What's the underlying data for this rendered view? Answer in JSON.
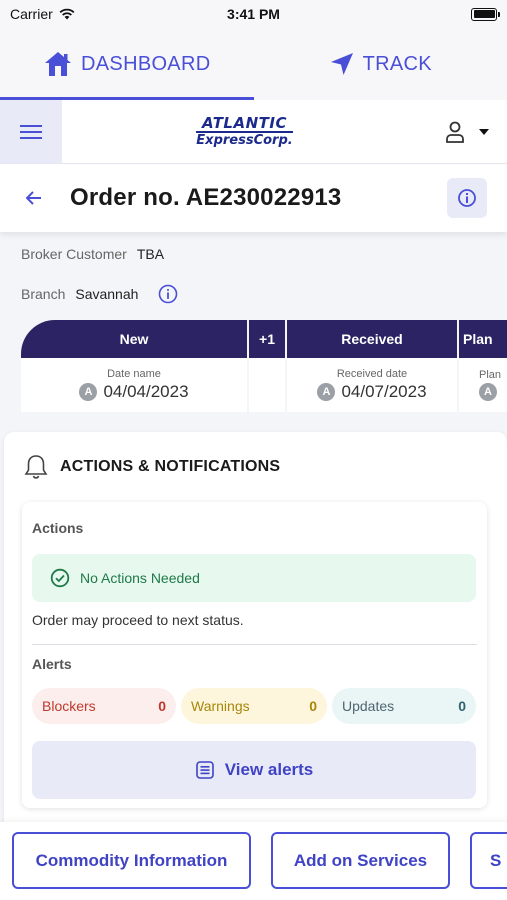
{
  "status_bar": {
    "carrier": "Carrier",
    "time": "3:41 PM"
  },
  "top_nav": {
    "dashboard_label": "DASHBOARD",
    "track_label": "TRACK"
  },
  "header": {
    "logo_line1": "ATLANTIC",
    "logo_line2": "ExpressCorp."
  },
  "order": {
    "title": "Order no.",
    "number": "AE230022913"
  },
  "meta": {
    "broker_label": "Broker Customer",
    "broker_value": "TBA",
    "branch_label": "Branch",
    "branch_value": "Savannah"
  },
  "stepper": {
    "steps": [
      {
        "name": "New",
        "date_label": "Date name",
        "date": "04/04/2023",
        "badge": "A"
      },
      {
        "name": "+1"
      },
      {
        "name": "Received",
        "date_label": "Received date",
        "date": "04/07/2023",
        "badge": "A"
      },
      {
        "name": "Plan",
        "date_label": "Plan",
        "badge": "A"
      }
    ]
  },
  "actions_card": {
    "title": "ACTIONS & NOTIFICATIONS",
    "actions_label": "Actions",
    "no_actions_text": "No Actions Needed",
    "proceed_text": "Order may proceed to next status.",
    "alerts_label": "Alerts",
    "alerts": [
      {
        "label": "Blockers",
        "count": "0"
      },
      {
        "label": "Warnings",
        "count": "0"
      },
      {
        "label": "Updates",
        "count": "0"
      }
    ],
    "view_alerts_label": "View alerts"
  },
  "bottom_buttons": {
    "commodity": "Commodity Information",
    "services": "Add on Services",
    "third": "S"
  },
  "colors": {
    "accent": "#4a4fd8",
    "stepper_header": "#2b2363",
    "success_bg": "#e7f8ee",
    "blocker_bg": "#fdeeee",
    "warning_bg": "#fdf6dc",
    "update_bg": "#eaf5f6"
  }
}
